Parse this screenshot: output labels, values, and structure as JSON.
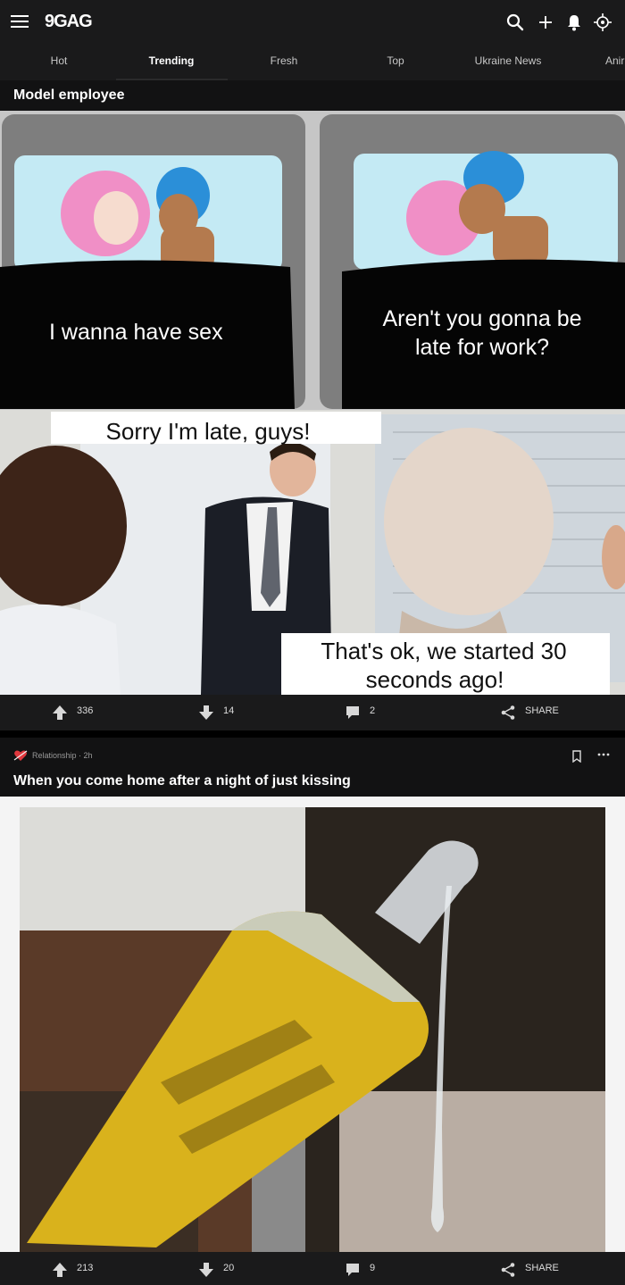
{
  "header": {
    "logo": "9GAG",
    "tabs": [
      {
        "label": "Hot"
      },
      {
        "label": "Trending"
      },
      {
        "label": "Fresh"
      },
      {
        "label": "Top"
      },
      {
        "label": "Ukraine News"
      },
      {
        "label": "Anir"
      }
    ],
    "active_tab": "Trending"
  },
  "posts": [
    {
      "title": "Model employee",
      "meme_text": {
        "panel1": "I wanna have sex",
        "panel2_line1": "Aren't you gonna be",
        "panel2_line2": "late for work?",
        "top_caption": "Sorry I'm late, guys!",
        "bottom_line1": "That's ok, we started 30",
        "bottom_line2": "seconds ago!"
      },
      "upvotes": "336",
      "downvotes": "14",
      "comments": "2",
      "share_label": "SHARE"
    },
    {
      "category_meta": "Relationship · 2h",
      "title": "When you come home after a night of just kissing",
      "upvotes": "213",
      "downvotes": "20",
      "comments": "9",
      "share_label": "SHARE"
    }
  ],
  "colors": {
    "background": "#000000",
    "bar": "#1a1a1b",
    "accent_tube": "#d9b21c"
  }
}
